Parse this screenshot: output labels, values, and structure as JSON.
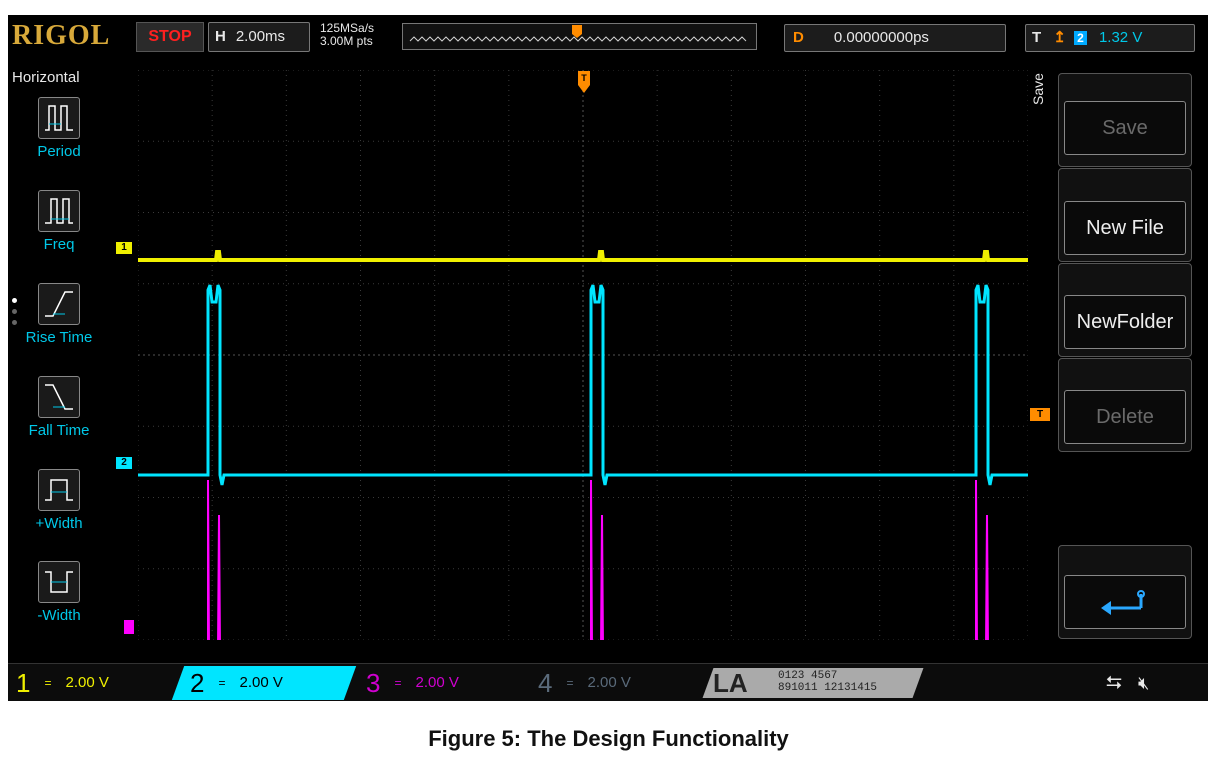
{
  "top": {
    "logo": "RIGOL",
    "run_state": "STOP",
    "horizontal_label": "H",
    "timebase": "2.00ms",
    "sample_rate": "125MSa/s",
    "memory_depth": "3.00M pts",
    "delay_label": "D",
    "delay_value": "0.00000000ps",
    "trigger_label": "T",
    "trigger_source": "2",
    "trigger_level": "1.32 V"
  },
  "left_menu": {
    "title": "Horizontal",
    "items": [
      {
        "label": "Period",
        "icon": "period-icon"
      },
      {
        "label": "Freq",
        "icon": "freq-icon"
      },
      {
        "label": "Rise Time",
        "icon": "rise-time-icon"
      },
      {
        "label": "Fall Time",
        "icon": "fall-time-icon"
      },
      {
        "label": "+Width",
        "icon": "pos-width-icon"
      },
      {
        "label": "-Width",
        "icon": "neg-width-icon"
      }
    ]
  },
  "right_menu": {
    "title": "Save",
    "buttons": [
      "Save",
      "New File",
      "NewFolder",
      "Delete"
    ],
    "return_icon": "return-icon"
  },
  "markers": {
    "ch1": "1",
    "ch2": "2",
    "trigger": "T"
  },
  "channels": [
    {
      "num": "1",
      "coupling": "=",
      "scale": "2.00 V",
      "color": "#f0f000"
    },
    {
      "num": "2",
      "coupling": "=",
      "scale": "2.00 V",
      "color": "#00e5ff"
    },
    {
      "num": "3",
      "coupling": "=",
      "scale": "2.00 V",
      "color": "#ff00ff"
    },
    {
      "num": "4",
      "coupling": "=",
      "scale": "2.00 V",
      "color": "#4a86c8"
    }
  ],
  "logic": {
    "label": "LA",
    "row1": "0123 4567",
    "row2": "891011 12131415"
  },
  "status_icons": [
    "usb-icon",
    "speaker-muted-icon"
  ],
  "colors": {
    "ch1": "#f0f000",
    "ch2": "#00e5ff",
    "ch3": "#ff00ff",
    "trigger": "#ff8c00",
    "menu_text": "#00c8e8"
  },
  "caption": "Figure 5: The Design Functionality"
}
